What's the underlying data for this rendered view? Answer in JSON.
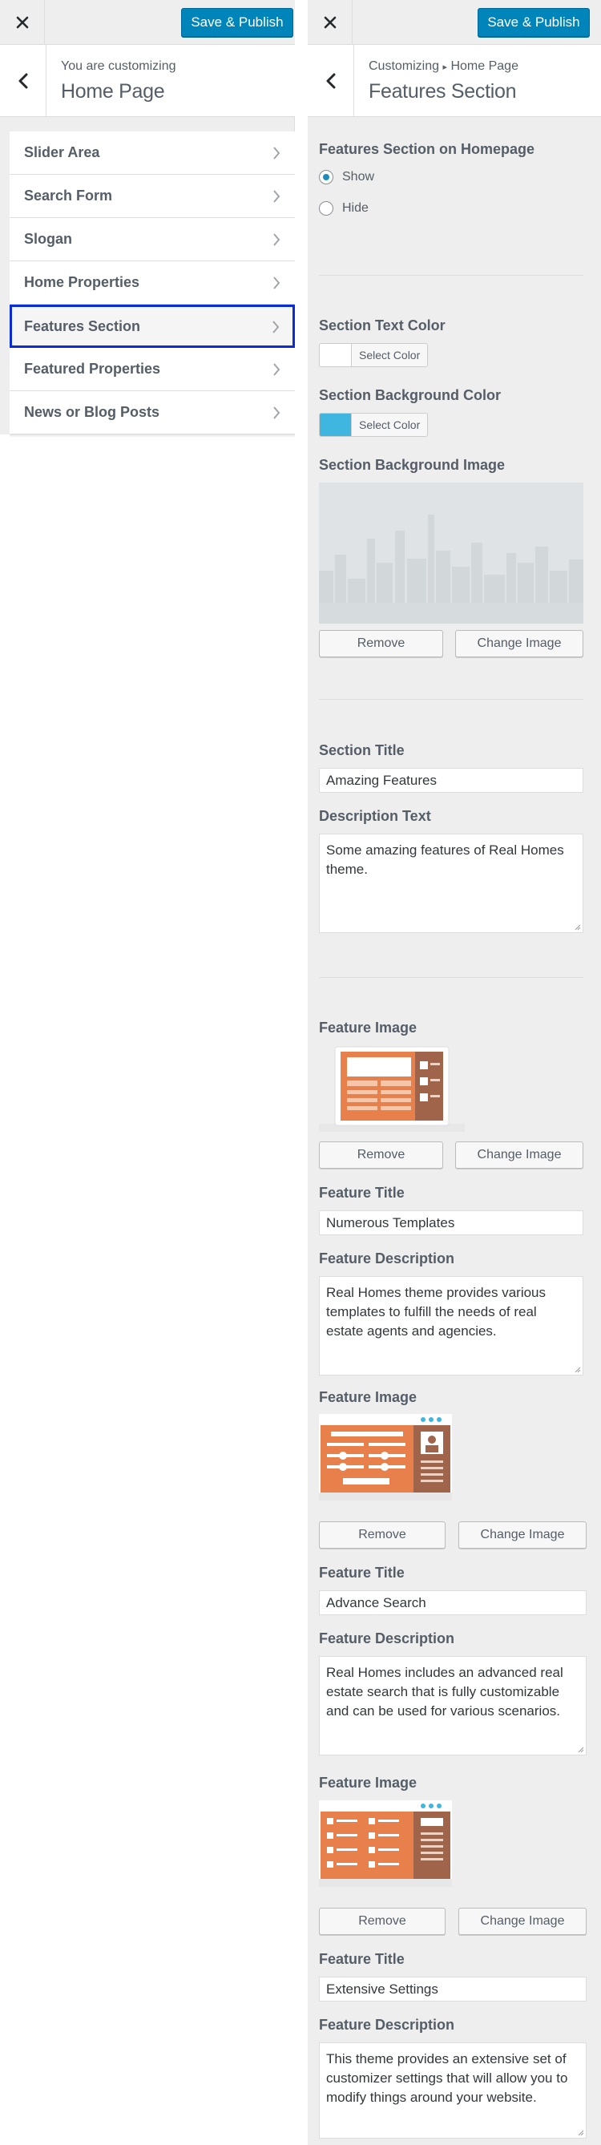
{
  "publish_label": "Save & Publish",
  "left": {
    "header_small": "You are customizing",
    "header_big": "Home Page",
    "sections": [
      {
        "label": "Slider Area"
      },
      {
        "label": "Search Form"
      },
      {
        "label": "Slogan"
      },
      {
        "label": "Home Properties"
      },
      {
        "label": "Features Section",
        "active": true
      },
      {
        "label": "Featured Properties"
      },
      {
        "label": "News or Blog Posts"
      }
    ]
  },
  "right": {
    "breadcrumb_root": "Customizing",
    "breadcrumb_sep": "▸",
    "breadcrumb_page": "Home Page",
    "header_big": "Features Section",
    "visibility": {
      "label": "Features Section on Homepage",
      "options": [
        "Show",
        "Hide"
      ],
      "selected": "Show"
    },
    "text_color": {
      "label": "Section Text Color",
      "button": "Select Color",
      "value": "#ffffff"
    },
    "bg_color": {
      "label": "Section Background Color",
      "button": "Select Color",
      "value": "#3eb6e0"
    },
    "bg_image": {
      "label": "Section Background Image",
      "remove": "Remove",
      "change": "Change Image"
    },
    "section_title": {
      "label": "Section Title",
      "value": "Amazing Features"
    },
    "description": {
      "label": "Description Text",
      "value": "Some amazing features of Real Homes theme."
    },
    "features": [
      {
        "image_label": "Feature Image",
        "remove": "Remove",
        "change": "Change Image",
        "icon": "templates-icon",
        "title_label": "Feature Title",
        "title": "Numerous Templates",
        "desc_label": "Feature Description",
        "desc": "Real Homes theme provides various templates to fulfill the needs of real estate agents and agencies."
      },
      {
        "image_label": "Feature Image",
        "remove": "Remove",
        "change": "Change Image",
        "icon": "advance-search-icon",
        "title_label": "Feature Title",
        "title": "Advance Search",
        "desc_label": "Feature Description",
        "desc": "Real Homes includes an advanced real estate search that is fully customizable and can be used for various scenarios."
      },
      {
        "image_label": "Feature Image",
        "remove": "Remove",
        "change": "Change Image",
        "icon": "settings-icon",
        "title_label": "Feature Title",
        "title": "Extensive Settings",
        "desc_label": "Feature Description",
        "desc": "This theme provides an extensive set of customizer settings that will allow you to modify things around your website."
      }
    ]
  },
  "colors": {
    "accent": "#0085ba",
    "active_outline": "#0a2bd8",
    "illustration": "#e8804c"
  }
}
